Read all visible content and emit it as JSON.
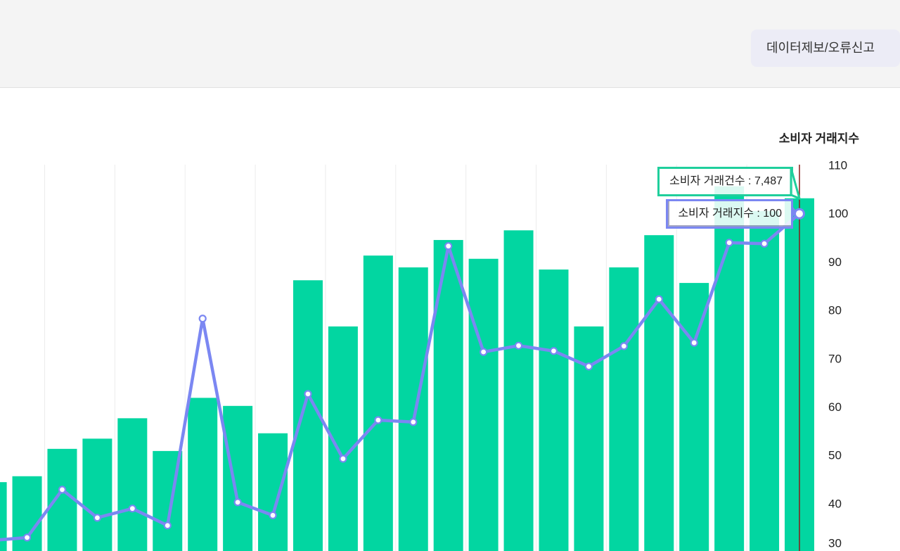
{
  "header": {
    "report_button_label": "데이터제보/오류신고"
  },
  "chart_data": {
    "type": "bar",
    "series": [
      {
        "name": "소비자 거래건수",
        "type": "bar",
        "values": [
          2200,
          2310,
          2820,
          3010,
          3390,
          2780,
          3770,
          3620,
          3110,
          5960,
          5100,
          6420,
          6200,
          6710,
          6360,
          6890,
          6160,
          5100,
          6200,
          6800,
          5910,
          7710,
          7250,
          7487
        ]
      },
      {
        "name": "소비자 거래지수",
        "type": "line",
        "values": [
          32.4,
          33.0,
          42.9,
          37.1,
          39.0,
          35.5,
          78.3,
          40.3,
          37.6,
          62.7,
          49.3,
          57.3,
          56.9,
          93.3,
          71.4,
          72.7,
          71.6,
          68.4,
          72.6,
          82.3,
          73.3,
          94.0,
          93.8,
          100
        ]
      }
    ],
    "y2label": "소비자 거래지수",
    "y2ticks": [
      110,
      100,
      90,
      80,
      70,
      60,
      50,
      40,
      30
    ],
    "y2lim": [
      30,
      110
    ],
    "grid": true,
    "hover_index": 23,
    "tooltip_separator": " : ",
    "tooltip": [
      {
        "value": "7,487"
      },
      {
        "value": "100"
      }
    ]
  },
  "colors": {
    "bar": "#02d6a1",
    "line": "#7b87f2",
    "crosshair": "#8b1a1a",
    "tooltip_count_border": "#1fcf9c",
    "tooltip_index_border": "#7b87f2",
    "grid": "#ececec"
  }
}
